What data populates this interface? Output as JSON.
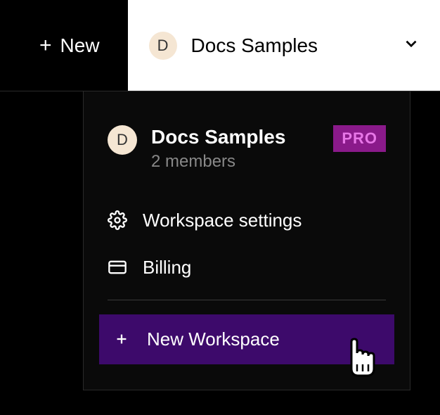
{
  "topbar": {
    "new_label": "New"
  },
  "selector": {
    "avatar_letter": "D",
    "workspace_name": "Docs Samples"
  },
  "dropdown": {
    "avatar_letter": "D",
    "workspace_name": "Docs Samples",
    "members_text": "2 members",
    "badge": "PRO",
    "menu": {
      "settings": "Workspace settings",
      "billing": "Billing"
    },
    "new_workspace_label": "New Workspace"
  }
}
